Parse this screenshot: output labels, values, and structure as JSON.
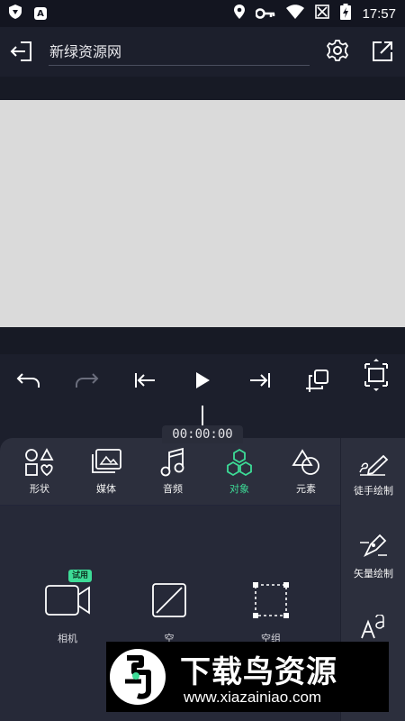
{
  "status_bar": {
    "time": "17:57",
    "left_icons": [
      "shield-icon",
      "a-box-icon"
    ],
    "right_icons": [
      "location-icon",
      "key-icon",
      "wifi-icon",
      "no-sim-icon",
      "battery-icon"
    ]
  },
  "header": {
    "title": "新绿资源网",
    "icons": [
      "exit-icon",
      "gear-icon",
      "share-icon"
    ]
  },
  "transport": {
    "icons": [
      "undo-icon",
      "redo-icon",
      "skip-start-icon",
      "play-icon",
      "skip-end-icon",
      "duplicate-icon",
      "fit-icon"
    ]
  },
  "timeline": {
    "timecode": "00:00:00"
  },
  "tabs": [
    {
      "label": "形状",
      "icon": "shapes-icon"
    },
    {
      "label": "媒体",
      "icon": "media-icon"
    },
    {
      "label": "音频",
      "icon": "music-note-icon"
    },
    {
      "label": "对象",
      "icon": "hexagons-icon",
      "active": true
    },
    {
      "label": "元素",
      "icon": "elements-icon"
    }
  ],
  "side_tools": [
    {
      "label": "徒手绘制",
      "icon": "freehand-pen-icon"
    },
    {
      "label": "矢量绘制",
      "icon": "vector-pen-icon"
    },
    {
      "label": "",
      "icon": "text-icon"
    }
  ],
  "objects": [
    {
      "label": "相机",
      "icon": "camera-icon",
      "badge": "试用"
    },
    {
      "label": "空",
      "icon": "null-object-icon"
    },
    {
      "label": "空组",
      "icon": "empty-group-icon"
    }
  ],
  "watermark": {
    "title": "下载鸟资源",
    "url": "www.xiazainiao.com"
  },
  "colors": {
    "accent": "#3ddc97",
    "background": "#1c1f2c",
    "panel": "#2c2f3d",
    "canvas": "#dadada"
  }
}
